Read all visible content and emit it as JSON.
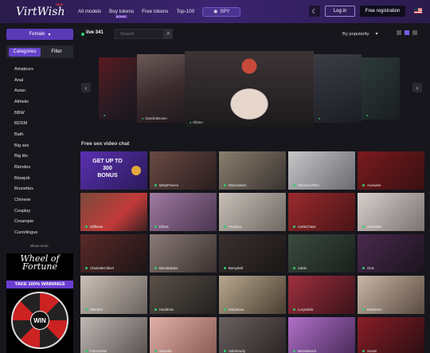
{
  "header": {
    "logo": "VirtWish",
    "logo_badge": "NEW",
    "nav": [
      "All models",
      "Buy tokens",
      "Free tokens",
      "Top-100"
    ],
    "nav_badge": "BONUS",
    "spy_label": "SPY",
    "login_label": "Log in",
    "register_label": "Free registration"
  },
  "sidebar": {
    "gender_label": "Female",
    "tabs": {
      "categories": "Categories",
      "filter": "Filter"
    },
    "categories": [
      "Amateurs",
      "Anal",
      "Asian",
      "Athletic",
      "BBW",
      "BDSM",
      "Bath",
      "Big ass",
      "Big tits",
      "Blondes",
      "Blowjob",
      "Brunettes",
      "Chinese",
      "Cosplay",
      "Creampie",
      "Cunnilingus"
    ],
    "show_more": "Show more",
    "banner": {
      "title": "Wheel of Fortune",
      "strip": "TAKE 100% WINNINGS",
      "center": "WIN"
    }
  },
  "toolbar": {
    "live_label": "live 341",
    "search_placeholder": "Search",
    "sort_label": "By popularity"
  },
  "carousel": {
    "items": [
      {
        "name": ""
      },
      {
        "name": "SandraBrown"
      },
      {
        "name": "Eliseo"
      },
      {
        "name": ""
      },
      {
        "name": ""
      }
    ]
  },
  "section_title": "Free sex video chat",
  "promo": {
    "line1": "GET UP TO",
    "line2": "300",
    "line3": "BONUS"
  },
  "models": [
    [
      "MistyPovecs",
      "RitaAmbers",
      "DianaAndTom",
      "Accaveis"
    ],
    [
      "WillMaia",
      "Elissa",
      "Paulinya",
      "CarlaChase",
      "ZoeBaker"
    ],
    [
      "CharlotteGilbert",
      "BlondeBabs",
      "BetsyBell",
      "Adele",
      "Onix"
    ],
    [
      "SkarletX",
      "HeidiKiss",
      "MaraRose",
      "LucyMiela",
      "BellaRom"
    ],
    [
      "FrancisMar",
      "Micaella",
      "SabrinaLily",
      "Meowbeach",
      "Susan"
    ]
  ],
  "colors": {
    "accent": "#6644cc",
    "live": "#2ecc71",
    "header": "#3b2470"
  }
}
